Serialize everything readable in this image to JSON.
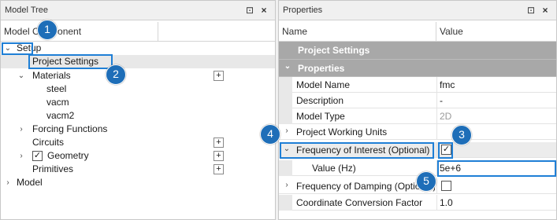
{
  "tree_pane": {
    "title": "Model Tree",
    "column_header_1": "Model Component",
    "column_header_2": "",
    "items": [
      {
        "label": "Setup"
      },
      {
        "label": "Project Settings"
      },
      {
        "label": "Materials"
      },
      {
        "label": "steel"
      },
      {
        "label": "vacm"
      },
      {
        "label": "vacm2"
      },
      {
        "label": "Forcing Functions"
      },
      {
        "label": "Circuits"
      },
      {
        "label": "Geometry"
      },
      {
        "label": "Primitives"
      },
      {
        "label": "Model"
      }
    ]
  },
  "props_pane": {
    "title": "Properties",
    "col_name": "Name",
    "col_value": "Value",
    "category_project": "Project Settings",
    "category_props": "Properties",
    "rows": [
      {
        "name": "Model Name",
        "value": "fmc"
      },
      {
        "name": "Description",
        "value": "-"
      },
      {
        "name": "Model Type",
        "value": "2D"
      },
      {
        "name": "Project Working Units",
        "value": ""
      },
      {
        "name": "Frequency of Interest (Optional)",
        "value": "✓"
      },
      {
        "name": "Value (Hz)",
        "value": "5e+6"
      },
      {
        "name": "Frequency of Damping (Optional)",
        "value": ""
      },
      {
        "name": "Coordinate Conversion Factor",
        "value": "1.0"
      }
    ]
  },
  "badges": [
    "1",
    "2",
    "3",
    "4",
    "5"
  ],
  "glyphs": {
    "pin": "⊡",
    "close": "×",
    "plus": "+",
    "check": "✓",
    "expanded": "⌄",
    "collapsed": "›"
  },
  "colors": {
    "accent": "#1e6eb8",
    "highlight_border": "#1f7fd6",
    "category_bg": "#a8a8a8"
  }
}
